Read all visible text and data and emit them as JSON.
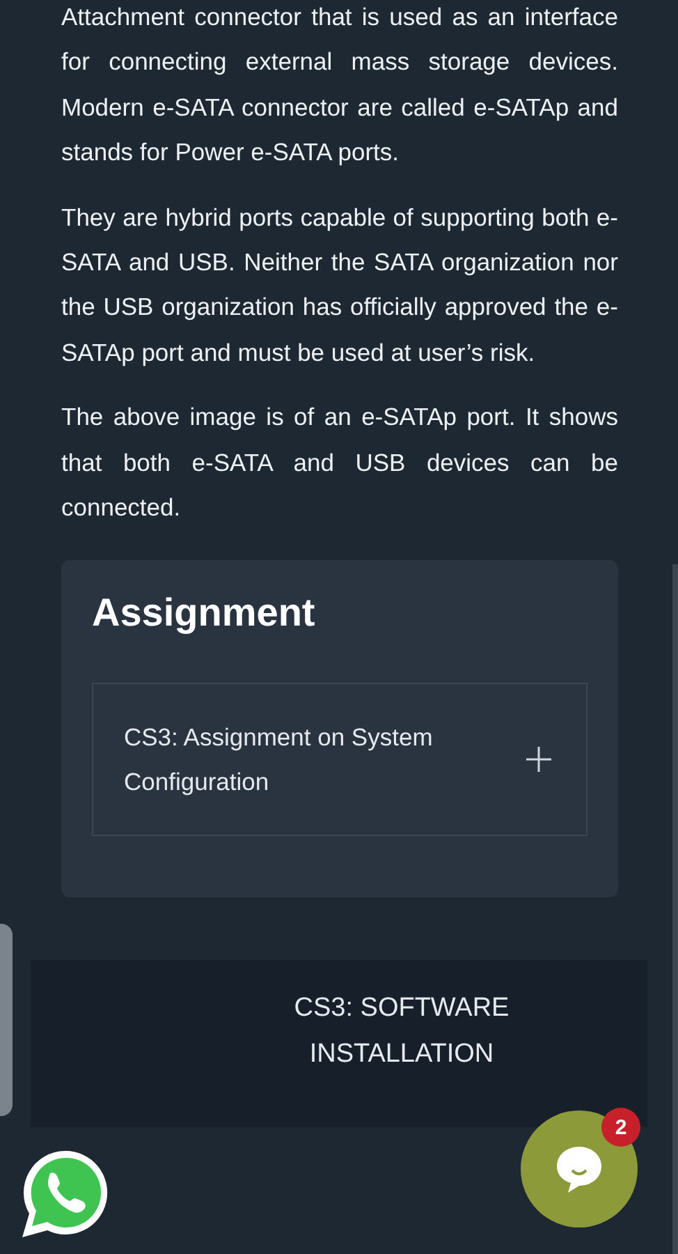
{
  "article": {
    "paragraphs": [
      "Attachment connector that is used as an interface for connecting external mass storage devices. Modern e-SATA connector are called e-SATAp and stands for Power e-SATA ports.",
      "They are hybrid ports capable of supporting both e-SATA and USB. Neither the SATA organization nor the USB organization has officially approved the e-SATAp port and must be used at user’s risk.",
      "The above image is of an e-SATAp port. It shows that both e-SATA and USB devices can be connected."
    ]
  },
  "assignment": {
    "title": "Assignment",
    "items": [
      {
        "label": "CS3: Assignment on System Configuration",
        "expanded": false
      }
    ]
  },
  "next_lesson": {
    "label": "CS3: SOFTWARE INSTALLATION"
  },
  "chat": {
    "badge": "2"
  }
}
